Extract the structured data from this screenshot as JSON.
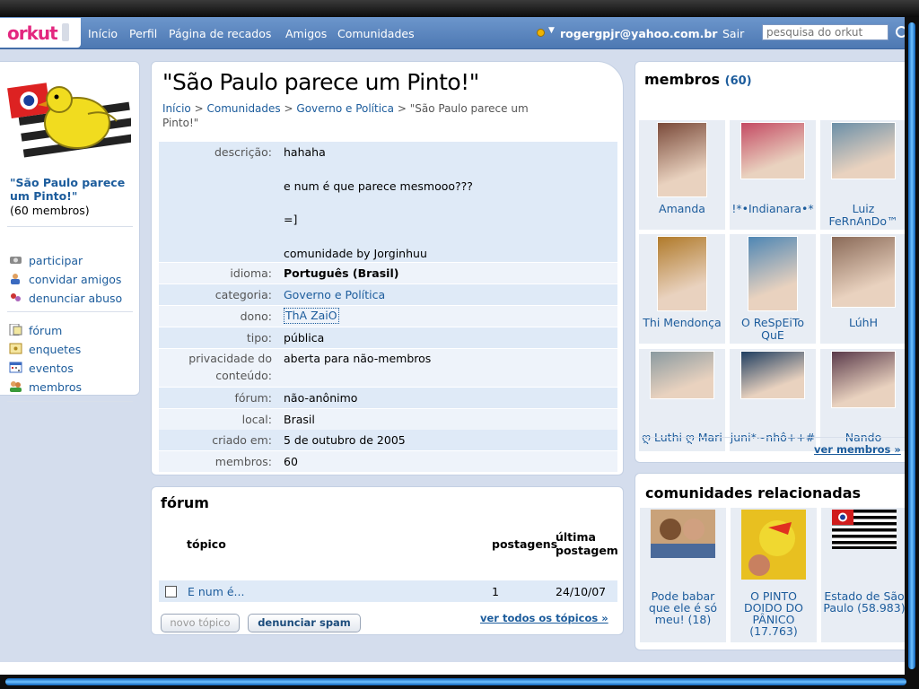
{
  "header": {
    "logo": "orkut",
    "nav": [
      "Início",
      "Perfil",
      "Página de recados",
      "Amigos",
      "Comunidades"
    ],
    "email": "rogergpjr@yahoo.com.br",
    "logout": "Sair",
    "search_placeholder": "pesquisa do orkut"
  },
  "sidebar": {
    "community_name": "\"São Paulo parece um Pinto!\"",
    "member_count": "(60 membros)",
    "actions": [
      {
        "label": "participar",
        "icon": "join-icon"
      },
      {
        "label": "convidar amigos",
        "icon": "invite-icon"
      },
      {
        "label": "denunciar abuso",
        "icon": "report-icon"
      }
    ],
    "sections": [
      {
        "label": "fórum",
        "icon": "forum-icon"
      },
      {
        "label": "enquetes",
        "icon": "polls-icon"
      },
      {
        "label": "eventos",
        "icon": "calendar-icon"
      },
      {
        "label": "membros",
        "icon": "members-icon"
      }
    ]
  },
  "main": {
    "title": "\"São Paulo parece um Pinto!\"",
    "breadcrumb": {
      "home": "Início",
      "communities": "Comunidades",
      "category": "Governo e Política",
      "current": "\"São Paulo parece um Pinto!\"",
      "separator": ">"
    },
    "description_label": "descrição:",
    "description_lines": [
      "hahaha",
      "e num é que parece mesmooo???",
      "=]",
      "comunidade by Jorginhuu"
    ],
    "info": [
      {
        "key": "idioma:",
        "value": "Português (Brasil)"
      },
      {
        "key": "categoria:",
        "value": "Governo e Política"
      },
      {
        "key": "dono:",
        "value": "ThA ZaiO"
      },
      {
        "key": "tipo:",
        "value": "pública"
      },
      {
        "key": "privacidade do conteúdo:",
        "value": "aberta para não-membros"
      },
      {
        "key": "fórum:",
        "value": "não-anônimo"
      },
      {
        "key": "local:",
        "value": "Brasil"
      },
      {
        "key": "criado em:",
        "value": "5 de outubro de 2005"
      },
      {
        "key": "membros:",
        "value": "60"
      }
    ]
  },
  "forum": {
    "title": "fórum",
    "col_topic": "tópico",
    "col_posts": "postagens",
    "col_last": "última postagem",
    "topics": [
      {
        "title": "E num é...",
        "posts": "1",
        "last": "24/10/07"
      }
    ],
    "new_topic": "novo tópico",
    "report_spam": "denunciar spam",
    "see_all": "ver todos os tópicos »"
  },
  "members": {
    "title": "membros",
    "count": "(60)",
    "list": [
      "Amanda",
      "!*•Indianara•*",
      "Luiz FeRnAnDo™",
      "Thi Mendonça",
      "O ReSpEiTo QuE",
      "LúhH",
      "ღ Luthi ღ Mari",
      "juni*~nhô++#",
      "Nando"
    ],
    "see_all": "ver membros »",
    "photo_colors": [
      "#7a4a3a",
      "#c44a63",
      "#6a8fa8",
      "#b07a2a",
      "#4e86b4",
      "#8a6a58",
      "#8a9aa0",
      "#1f3e60",
      "#5a3a4a"
    ]
  },
  "related": {
    "title": "comunidades relacionadas",
    "list": [
      "Pode babar que ele é só meu! (18)",
      "O PINTO DOIDO DO PÂNICO (17.763)",
      "Estado de São Paulo (58.983)"
    ]
  }
}
